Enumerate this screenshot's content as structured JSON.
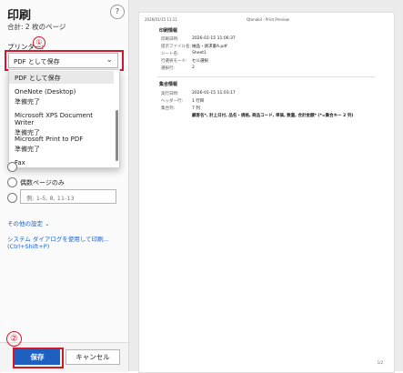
{
  "dialog": {
    "title": "印刷",
    "subtitle": "合計: 2 枚のページ",
    "help_icon": "?",
    "printer_label": "プリンター:",
    "marker_1": "①",
    "marker_2": "②",
    "selected_printer": "PDF として保存",
    "chevron": "⌄"
  },
  "printer_options": [
    {
      "name": "PDF として保存",
      "status": ""
    },
    {
      "name": "OneNote (Desktop)",
      "status": "準備完了"
    },
    {
      "name": "Microsoft XPS Document Writer",
      "status": "準備完了"
    },
    {
      "name": "Microsoft Print to PDF",
      "status": "準備完了"
    },
    {
      "name": "Fax",
      "status": ""
    }
  ],
  "pages": {
    "even_pages_label": "偶数ページのみ",
    "range_placeholder": "例: 1-5, 8, 11-13"
  },
  "links": {
    "more_settings": "その他の設定 ⌄",
    "system_dialog": "システム ダイアログを使用して印刷... (Ctrl+Shift+P)"
  },
  "buttons": {
    "save": "保存",
    "cancel": "キャンセル"
  },
  "preview": {
    "header_left": "2026/01/15 11:11",
    "header_center": "Qtenabil - Print Preview",
    "section1_title": "印刷情報",
    "rows1": [
      {
        "key": "印刷日時:",
        "value": "2026-01-15 11:06:37"
      },
      {
        "key": "提示ファイル名:",
        "value": "納品・請求書A.pdf"
      },
      {
        "key": "シート名:",
        "value": "Sheet1"
      },
      {
        "key": "行選択モード:",
        "value": "セル選択"
      },
      {
        "key": "選択行:",
        "value": "2"
      }
    ],
    "section2_title": "集合情報",
    "rows2": [
      {
        "key": "実行日時:",
        "value": "2026-01-15 11:03:17"
      },
      {
        "key": "ヘッダー行:",
        "value": "1 行目"
      },
      {
        "key": "集合列:",
        "value": "7 列"
      }
    ],
    "columns_line": "顧客名*, 計上日付, 品名・規格, 商品コード, 単価, 数量, 合計金額* (*=集合キー 2 列)",
    "page_number": "1/2"
  }
}
